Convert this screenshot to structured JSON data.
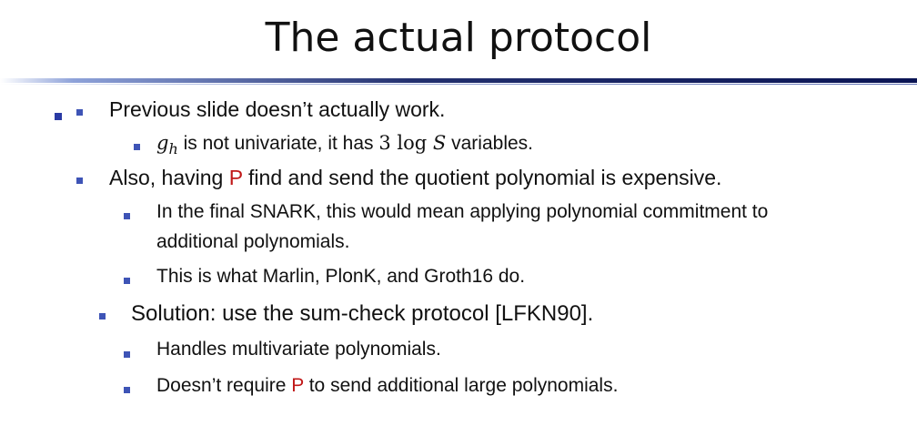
{
  "title": "The actual protocol",
  "items": {
    "i1": "Previous slide doesn’t actually work.",
    "i1a_var": "g",
    "i1a_sub": "h",
    "i1a_text": " is not univariate, it has ",
    "i1a_num": "3 log ",
    "i1a_S": "S",
    "i1a_tail": " variables.",
    "i2_pre": "Also, having ",
    "i2_p": "P",
    "i2_post": " find and send the quotient polynomial is expensive.",
    "i2a_line1": "In the final SNARK, this would mean applying polynomial commitment to",
    "i2a_line2": "additional polynomials.",
    "i2b": "This is what Marlin, PlonK, and Groth16 do.",
    "i3": "Solution: use the sum-check protocol [LFKN90].",
    "i3a": "Handles multivariate polynomials.",
    "i3b_pre": "Doesn’t require ",
    "i3b_p": "P",
    "i3b_post": " to send additional large polynomials."
  },
  "colors": {
    "bullet": "#3e54b6",
    "highlight_p": "#c01818",
    "rule": "#0a1454"
  }
}
